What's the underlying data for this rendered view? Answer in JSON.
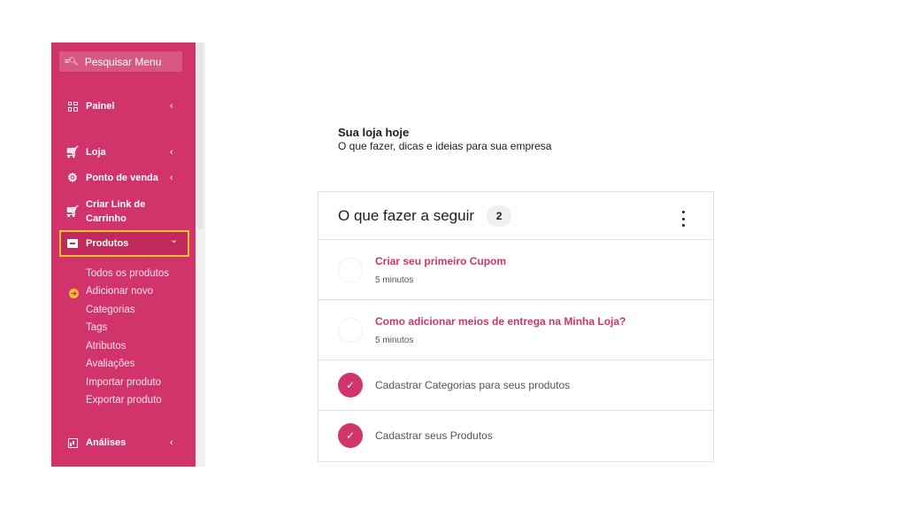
{
  "sidebar": {
    "search_label": "Pesquisar Menu",
    "search_icon": "search-menu-icon",
    "items": [
      {
        "label": "Painel",
        "icon": "dashboard-icon"
      },
      {
        "label": "Loja",
        "icon": "cart-icon"
      },
      {
        "label": "Ponto de venda",
        "icon": "gear-icon"
      },
      {
        "label": "Criar Link de\nCarrinho",
        "line1": "Criar Link de",
        "line2": "Carrinho",
        "icon": "cart-icon"
      },
      {
        "label": "Produtos",
        "icon": "box-icon",
        "chevron": "down"
      },
      {
        "label": "Análises",
        "icon": "chart-icon"
      }
    ],
    "chevron_left": "‹",
    "chevron_down": "⌄",
    "sub_items": [
      "Todos os produtos",
      "Adicionar novo",
      "Categorias",
      "Tags",
      "Atributos",
      "Avaliações",
      "Importar produto",
      "Exportar produto"
    ],
    "colors": {
      "background": "#d0346a",
      "highlight": "#f2c12e"
    }
  },
  "main": {
    "title": "Sua loja hoje",
    "subtitle": "O que fazer, dicas e ideias para sua empresa",
    "card": {
      "title": "O que fazer a seguir",
      "count": "2",
      "tasks": [
        {
          "title": "Criar seu primeiro Cupom",
          "time": "5 minutos",
          "done": false
        },
        {
          "title": "Como adicionar meios de entrega na Minha Loja?",
          "time": "5 minutos",
          "done": false
        },
        {
          "title": "Cadastrar Categorias para seus produtos",
          "done": true
        },
        {
          "title": "Cadastrar seus Produtos",
          "done": true
        }
      ]
    },
    "colors": {
      "accent": "#d0346a"
    }
  }
}
